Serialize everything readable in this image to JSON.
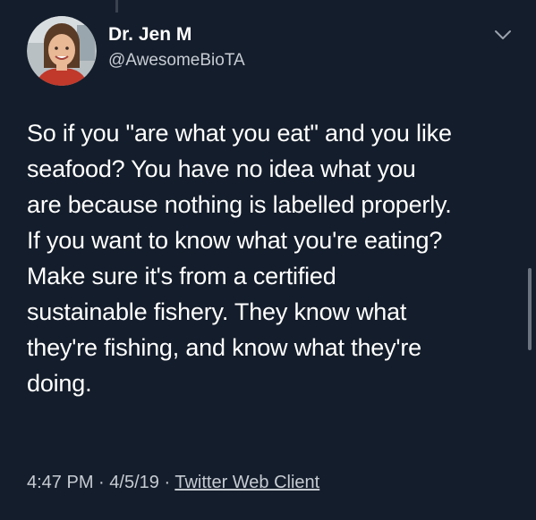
{
  "colors": {
    "background": "#141d2b",
    "text_primary": "#ffffff",
    "text_secondary": "#c7ccd3"
  },
  "author": {
    "display_name": "Dr. Jen M",
    "handle": "@AwesomeBioTA",
    "avatar_icon": "profile-photo"
  },
  "menu": {
    "icon": "chevron-down-icon"
  },
  "tweet": {
    "lines": [
      "So if you \"are what you eat\" and you like",
      "seafood? You have no idea what you",
      "are because nothing is labelled properly.",
      "If you want to know what you're eating?",
      "Make sure it's from a certified",
      "sustainable fishery. They know what",
      "they're fishing, and know what they're",
      "doing."
    ]
  },
  "meta": {
    "time": "4:47 PM",
    "separator": "·",
    "date": "4/5/19",
    "client": "Twitter Web Client"
  }
}
